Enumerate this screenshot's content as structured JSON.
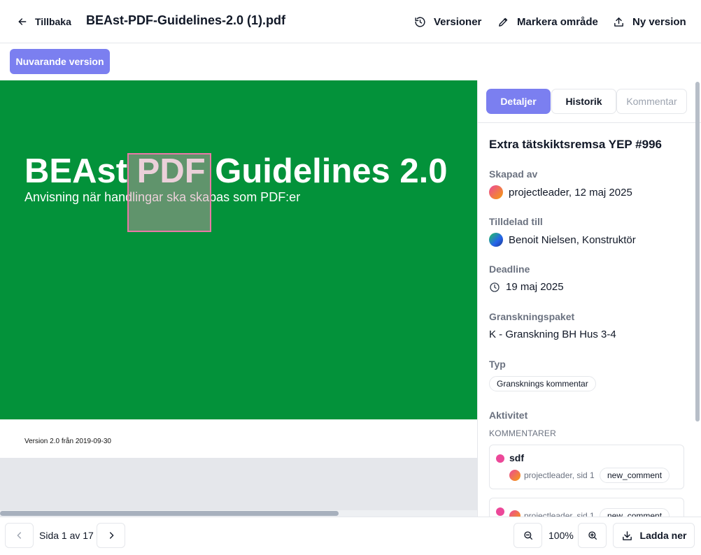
{
  "header": {
    "back_label": "Tillbaka",
    "document_title": "BEAst-PDF-Guidelines-2.0 (1).pdf",
    "versions_label": "Versioner",
    "mark_area_label": "Markera område",
    "new_version_label": "Ny version"
  },
  "version_bar": {
    "current_version_label": "Nuvarande version"
  },
  "pdf_page": {
    "title": "BEAst PDF Guidelines 2.0",
    "subtitle": "Anvisning när handlingar ska skapas som PDF:er",
    "version_note": "Version 2.0 från 2019-09-30",
    "cover_color": "#03923a",
    "markup_color": "#e879a6"
  },
  "panel": {
    "tabs": [
      {
        "label": "Detaljer",
        "active": true
      },
      {
        "label": "Historik",
        "active": false
      },
      {
        "label": "Kommentar",
        "active": false
      }
    ],
    "issue_title": "Extra tätskiktsremsa YEP #996",
    "created_by_label": "Skapad av",
    "created_by_value": "projectleader, 12 maj 2025",
    "assigned_to_label": "Tilldelad till",
    "assigned_to_value": "Benoit Nielsen, Konstruktör",
    "deadline_label": "Deadline",
    "deadline_value": "19 maj 2025",
    "package_label": "Granskningspaket",
    "package_value": "K - Granskning BH Hus 3-4",
    "type_label": "Typ",
    "type_value": "Gransknings kommentar",
    "activity_label": "Aktivitet",
    "comments_label": "KOMMENTARER",
    "comments": [
      {
        "text": "sdf",
        "meta": "projectleader, sid 1",
        "badge": "new_comment"
      },
      {
        "text": "",
        "meta": "projectleader, sid 1",
        "badge": "new_comment"
      }
    ]
  },
  "footer": {
    "page_info": "Sida 1 av 17",
    "zoom": "100%",
    "download_label": "Ladda ner"
  },
  "colors": {
    "accent": "#7b7ff0",
    "comment_dot": "#ec4899"
  }
}
